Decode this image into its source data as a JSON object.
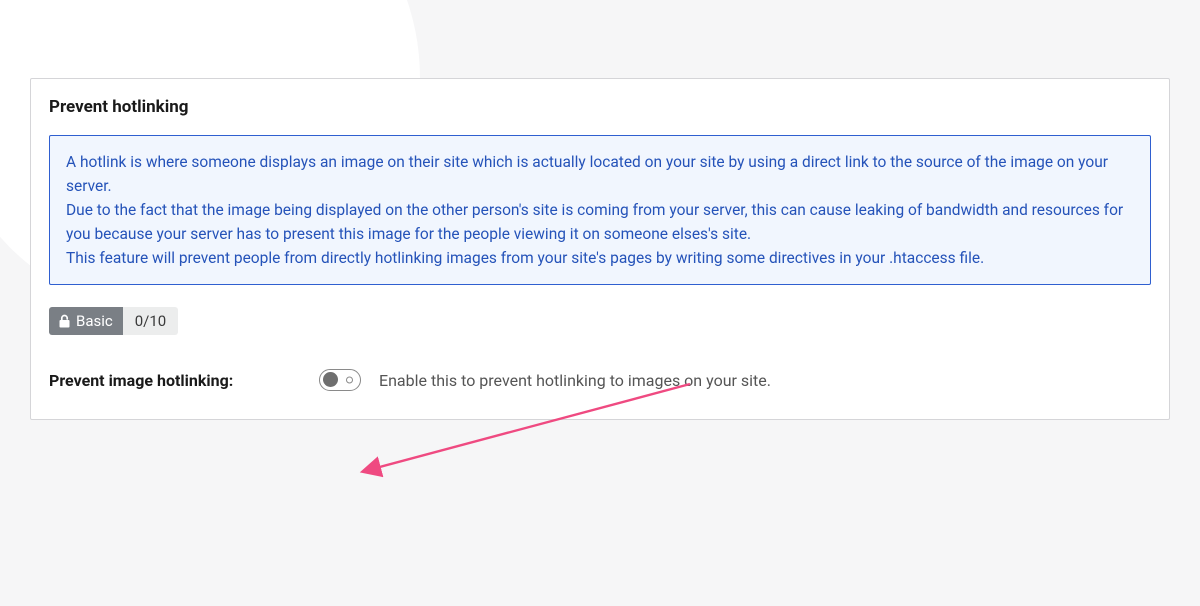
{
  "card": {
    "title": "Prevent hotlinking",
    "info": {
      "p1": "A hotlink is where someone displays an image on their site which is actually located on your site by using a direct link to the source of the image on your server.",
      "p2": "Due to the fact that the image being displayed on the other person's site is coming from your server, this can cause leaking of bandwidth and resources for you because your server has to present this image for the people viewing it on someone elses's site.",
      "p3": "This feature will prevent people from directly hotlinking images from your site's pages by writing some directives in your .htaccess file."
    },
    "badge": {
      "level": "Basic",
      "score": "0/10"
    },
    "setting": {
      "label": "Prevent image hotlinking:",
      "enabled": false,
      "description": "Enable this to prevent hotlinking to images on your site."
    }
  }
}
